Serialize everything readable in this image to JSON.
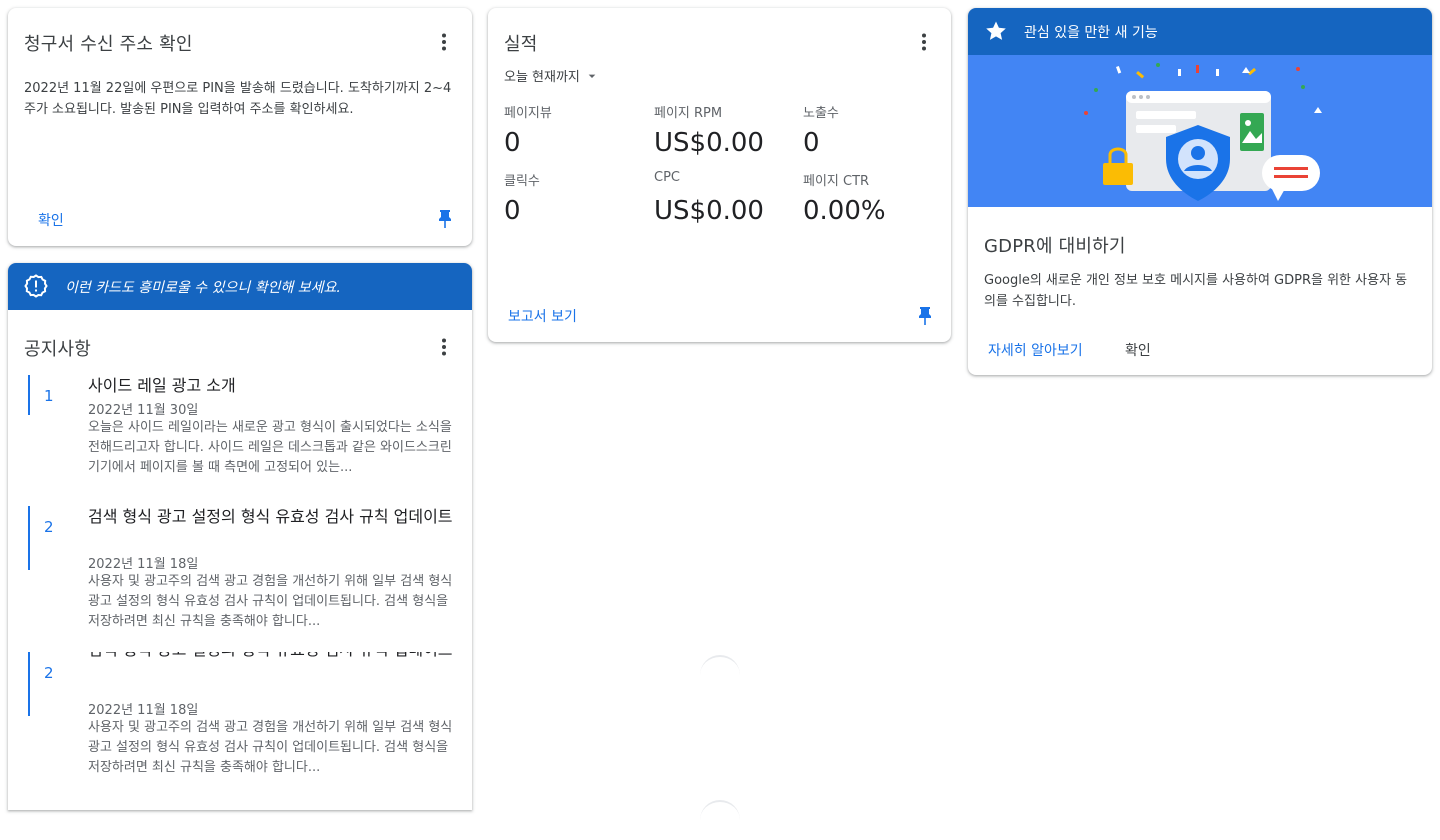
{
  "billing_card": {
    "title": "청구서 수신 주소 확인",
    "body": "2022년 11월 22일에 우편으로 PIN을 발송해 드렸습니다. 도착하기까지 2~4주가 소요됩니다. 발송된 PIN을 입력하여 주소를 확인하세요.",
    "action_label": "확인"
  },
  "interest_card": {
    "banner_text": "이런 카드도 흥미로울 수 있으니 확인해 보세요.",
    "title": "공지사항",
    "notices": [
      {
        "number": "1",
        "title": "사이드 레일 광고 소개",
        "date": "2022년 11월 30일",
        "description": "오늘은 사이드 레일이라는 새로운 광고 형식이 출시되었다는 소식을 전해드리고자 합니다. 사이드 레일은 데스크톱과 같은 와이드스크린 기기에서 페이지를 볼 때 측면에 고정되어 있는..."
      },
      {
        "number": "2",
        "title": "검색 형식 광고 설정의 형식 유효성 검사 규칙 업데이트",
        "date": "2022년 11월 18일",
        "description": "사용자 및 광고주의 검색 광고 경험을 개선하기 위해 일부 검색 형식 광고 설정의 형식 유효성 검사 규칙이 업데이트됩니다. 검색 형식을 저장하려면 최신 규칙을 충족해야 합니다..."
      },
      {
        "number": "2",
        "title": "검색 형식 광고 설정의 형식 유효성 검사 규칙 업데이트",
        "date": "2022년 11월 18일",
        "description": "사용자 및 광고주의 검색 광고 경험을 개선하기 위해 일부 검색 형식 광고 설정의 형식 유효성 검사 규칙이 업데이트됩니다. 검색 형식을 저장하려면 최신 규칙을 충족해야 합니다..."
      }
    ]
  },
  "performance_card": {
    "title": "실적",
    "period": "오늘 현재까지",
    "metrics": [
      {
        "label": "페이지뷰",
        "value": "0"
      },
      {
        "label": "페이지 RPM",
        "value": "US$0.00"
      },
      {
        "label": "노출수",
        "value": "0"
      },
      {
        "label": "클릭수",
        "value": "0"
      },
      {
        "label": "CPC",
        "value": "US$0.00"
      },
      {
        "label": "페이지 CTR",
        "value": "0.00%"
      }
    ],
    "report_link": "보고서 보기"
  },
  "gdpr_card": {
    "banner_text": "관심 있을 만한 새 기능",
    "title": "GDPR에 대비하기",
    "body": "Google의 새로운 개인 정보 보호 메시지를 사용하여 GDPR을 위한 사용자 동의를 수집합니다.",
    "learn_more": "자세히 알아보기",
    "confirm": "확인"
  },
  "colors": {
    "accent": "#1a73e8",
    "banner": "#1565c0",
    "hero": "#4285f4"
  },
  "icons": [
    "more-vert-icon",
    "pin-icon",
    "feedback-icon",
    "star-icon",
    "dropdown-arrow-icon"
  ]
}
